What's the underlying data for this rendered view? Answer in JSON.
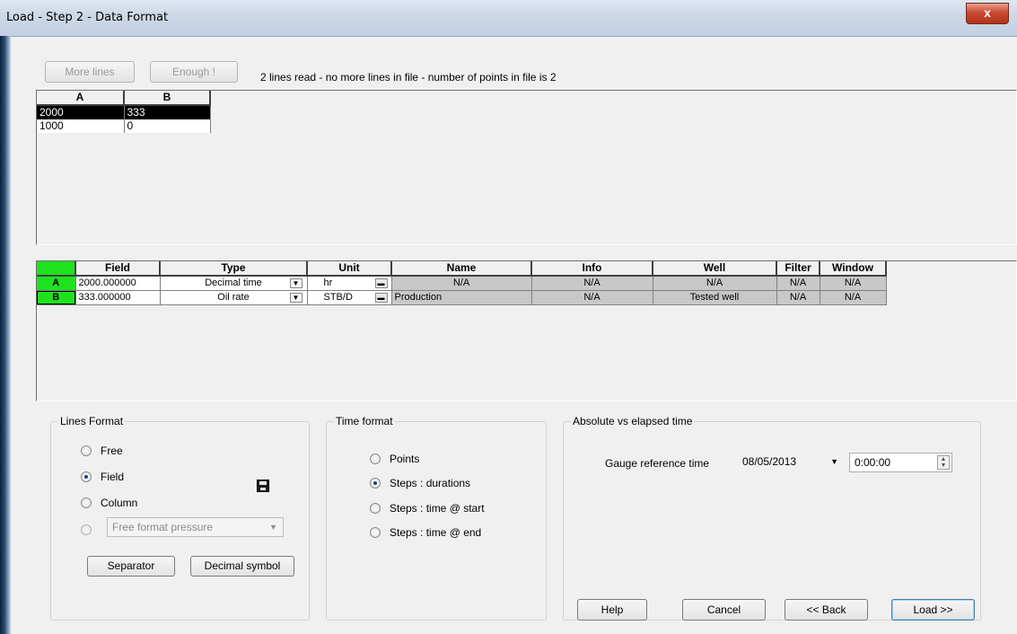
{
  "window": {
    "title": "Load - Step 2 - Data Format",
    "close_glyph": "x"
  },
  "toolbar": {
    "more_lines_label": "More lines",
    "enough_label": "Enough !",
    "status_text": "2 lines read - no more lines in file - number of points in file is 2"
  },
  "raw_grid": {
    "headers": [
      "A",
      "B"
    ],
    "rows": [
      {
        "a": "2000",
        "b": "333",
        "selected": true
      },
      {
        "a": "1000",
        "b": "0",
        "selected": false
      }
    ]
  },
  "format_grid": {
    "headers": [
      "Field",
      "Type",
      "Unit",
      "Name",
      "Info",
      "Well",
      "Filter",
      "Window"
    ],
    "rows": [
      {
        "row": "A",
        "field": "2000.000000",
        "type": "Decimal time",
        "unit": "hr",
        "name": "N/A",
        "info": "N/A",
        "well": "N/A",
        "filter": "N/A",
        "window": "N/A"
      },
      {
        "row": "B",
        "field": "333.000000",
        "type": "Oil rate",
        "unit": "STB/D",
        "name": "Production",
        "info": "N/A",
        "well": "Tested well",
        "filter": "N/A",
        "window": "N/A"
      }
    ]
  },
  "lines_format": {
    "label": "Lines Format",
    "options": [
      "Free",
      "Field",
      "Column"
    ],
    "selected": "Field",
    "combo_value": "Free format pressure",
    "separator_label": "Separator",
    "decimal_label": "Decimal symbol"
  },
  "time_format": {
    "label": "Time format",
    "options": [
      "Points",
      "Steps : durations",
      "Steps : time @ start",
      "Steps : time @ end"
    ],
    "selected": "Steps : durations"
  },
  "abs_elapsed": {
    "label": "Absolute vs elapsed time",
    "gauge_label": "Gauge reference time",
    "date_value": "08/05/2013",
    "time_value": "0:00:00"
  },
  "footer": {
    "help_label": "Help",
    "cancel_label": "Cancel",
    "back_label": "<< Back",
    "load_label": "Load >>"
  }
}
